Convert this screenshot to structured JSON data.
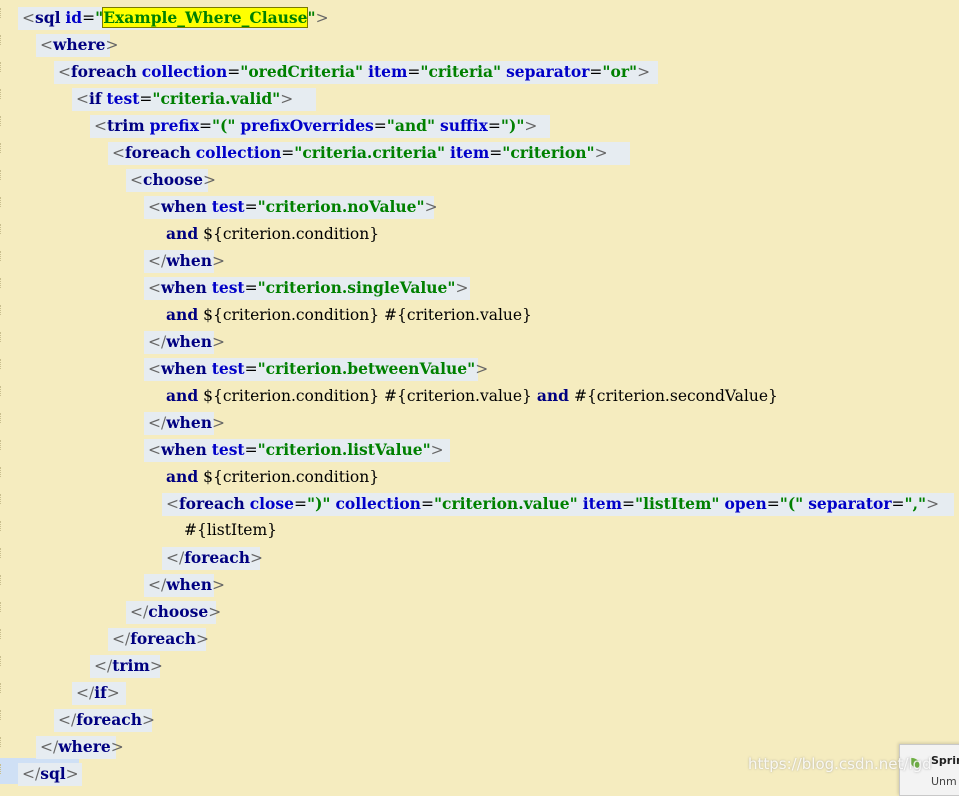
{
  "editor": {
    "lines": [
      {
        "indent": 0,
        "html": "<span class='br'>&lt;</span><span class='tg'>sql</span> <span class='at'>id</span><span class='eq'>=</span><span class='vl'>\"</span><span class='hl'>Example_Where_Clause</span><span class='vl'>\"</span><span class='br'>&gt;</span>",
        "w": 280
      },
      {
        "indent": 1,
        "html": "<span class='br'>&lt;</span><span class='tg'>where</span><span class='br'>&gt;</span>",
        "w": 66
      },
      {
        "indent": 2,
        "html": "<span class='br'>&lt;</span><span class='tg'>foreach</span> <span class='at'>collection</span><span class='eq'>=</span><span class='vl'>\"oredCriteria\"</span> <span class='at'>item</span><span class='eq'>=</span><span class='vl'>\"criteria\"</span> <span class='at'>separator</span><span class='eq'>=</span><span class='vl'>\"or\"</span><span class='br'>&gt;</span>",
        "w": 596
      },
      {
        "indent": 3,
        "html": "<span class='br'>&lt;</span><span class='tg'>if</span> <span class='at'>test</span><span class='eq'>=</span><span class='vl'>\"criteria.valid\"</span><span class='br'>&gt;</span>",
        "w": 236
      },
      {
        "indent": 4,
        "html": "<span class='br'>&lt;</span><span class='tg'>trim</span> <span class='at'>prefix</span><span class='eq'>=</span><span class='vl'>\"(\"</span> <span class='at'>prefixOverrides</span><span class='eq'>=</span><span class='vl'>\"and\"</span> <span class='at'>suffix</span><span class='eq'>=</span><span class='vl'>\")\"</span><span class='br'>&gt;</span>",
        "w": 452
      },
      {
        "indent": 5,
        "html": "<span class='br'>&lt;</span><span class='tg'>foreach</span> <span class='at'>collection</span><span class='eq'>=</span><span class='vl'>\"criteria.criteria\"</span> <span class='at'>item</span><span class='eq'>=</span><span class='vl'>\"criterion\"</span><span class='br'>&gt;</span>",
        "w": 514
      },
      {
        "indent": 6,
        "html": "<span class='br'>&lt;</span><span class='tg'>choose</span><span class='br'>&gt;</span>",
        "w": 74
      },
      {
        "indent": 7,
        "html": "<span class='br'>&lt;</span><span class='tg'>when</span> <span class='at'>test</span><span class='eq'>=</span><span class='vl'>\"criterion.noValue\"</span><span class='br'>&gt;</span>",
        "w": 282
      },
      {
        "indent": 8,
        "html": "<span class='kw'>and</span> <span class='ex'>${criterion.condition}</span>",
        "w": 0
      },
      {
        "indent": 7,
        "html": "<span class='br'>&lt;/</span><span class='tg'>when</span><span class='br'>&gt;</span>",
        "w": 62
      },
      {
        "indent": 7,
        "html": "<span class='br'>&lt;</span><span class='tg'>when</span> <span class='at'>test</span><span class='eq'>=</span><span class='vl'>\"criterion.singleValue\"</span><span class='br'>&gt;</span>",
        "w": 318
      },
      {
        "indent": 8,
        "html": "<span class='kw'>and</span> <span class='ex'>${criterion.condition} #{criterion.value}</span>",
        "w": 0
      },
      {
        "indent": 7,
        "html": "<span class='br'>&lt;/</span><span class='tg'>when</span><span class='br'>&gt;</span>",
        "w": 62
      },
      {
        "indent": 7,
        "html": "<span class='br'>&lt;</span><span class='tg'>when</span> <span class='at'>test</span><span class='eq'>=</span><span class='vl'>\"criterion.betweenValue\"</span><span class='br'>&gt;</span>",
        "w": 326
      },
      {
        "indent": 8,
        "html": "<span class='kw'>and</span> <span class='ex'>${criterion.condition} #{criterion.value}</span> <span class='kw'>and</span> <span class='ex'>#{criterion.secondValue}</span>",
        "w": 0
      },
      {
        "indent": 7,
        "html": "<span class='br'>&lt;/</span><span class='tg'>when</span><span class='br'>&gt;</span>",
        "w": 62
      },
      {
        "indent": 7,
        "html": "<span class='br'>&lt;</span><span class='tg'>when</span> <span class='at'>test</span><span class='eq'>=</span><span class='vl'>\"criterion.listValue\"</span><span class='br'>&gt;</span>",
        "w": 298
      },
      {
        "indent": 8,
        "html": "<span class='kw'>and</span> <span class='ex'>${criterion.condition}</span>",
        "w": 0
      },
      {
        "indent": 8,
        "html": "<span class='br'>&lt;</span><span class='tg'>foreach</span> <span class='at'>close</span><span class='eq'>=</span><span class='vl'>\")\"</span> <span class='at'>collection</span><span class='eq'>=</span><span class='vl'>\"criterion.value\"</span> <span class='at'>item</span><span class='eq'>=</span><span class='vl'>\"listItem\"</span> <span class='at'>open</span><span class='eq'>=</span><span class='vl'>\"(\"</span> <span class='at'>separator</span><span class='eq'>=</span><span class='vl'>\",\"</span><span class='br'>&gt;</span>",
        "w": 784
      },
      {
        "indent": 9,
        "html": "<span class='ex'>#{listItem}</span>",
        "w": 0
      },
      {
        "indent": 8,
        "html": "<span class='br'>&lt;/</span><span class='tg'>foreach</span><span class='br'>&gt;</span>",
        "w": 90
      },
      {
        "indent": 7,
        "html": "<span class='br'>&lt;/</span><span class='tg'>when</span><span class='br'>&gt;</span>",
        "w": 62
      },
      {
        "indent": 6,
        "html": "<span class='br'>&lt;/</span><span class='tg'>choose</span><span class='br'>&gt;</span>",
        "w": 82
      },
      {
        "indent": 5,
        "html": "<span class='br'>&lt;/</span><span class='tg'>foreach</span><span class='br'>&gt;</span>",
        "w": 90
      },
      {
        "indent": 4,
        "html": "<span class='br'>&lt;/</span><span class='tg'>trim</span><span class='br'>&gt;</span>",
        "w": 62
      },
      {
        "indent": 3,
        "html": "<span class='br'>&lt;/</span><span class='tg'>if</span><span class='br'>&gt;</span>",
        "w": 46
      },
      {
        "indent": 2,
        "html": "<span class='br'>&lt;/</span><span class='tg'>foreach</span><span class='br'>&gt;</span>",
        "w": 90
      },
      {
        "indent": 1,
        "html": "<span class='br'>&lt;/</span><span class='tg'>where</span><span class='br'>&gt;</span>",
        "w": 72
      },
      {
        "indent": 0,
        "html": "<span class='br'>&lt;/</span><span class='tg'>sql</span><span class='br'>&gt;</span>",
        "w": 56
      }
    ]
  },
  "popup": {
    "title": "Sprin",
    "subtitle": "Unm"
  },
  "watermark": "https://blog.csdn.net/lgd",
  "colors": {
    "background": "#f5ecbf",
    "tag": "#000080",
    "attribute": "#0000c8",
    "value": "#008000",
    "highlight": "#ffff00"
  }
}
